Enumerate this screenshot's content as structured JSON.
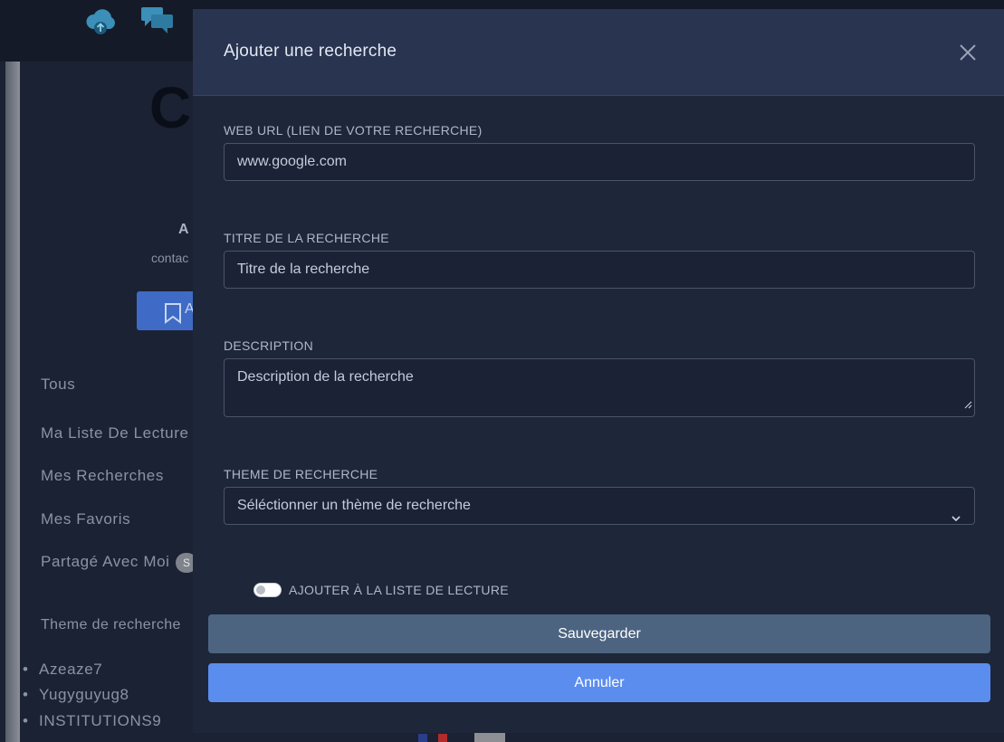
{
  "background": {
    "logo_text": "C",
    "profile_name": "A",
    "profile_email": "contac",
    "add_button_label": "A",
    "nav_items": [
      "Tous",
      "Ma Liste De Lecture",
      "Mes Recherches",
      "Mes Favoris",
      "Partagé Avec Moi"
    ],
    "shared_badge": "S",
    "themes_heading": "Theme de recherche",
    "theme_items": [
      "Azeaze7",
      "Yugyguyug8",
      "INSTITUTIONS9"
    ]
  },
  "modal": {
    "title": "Ajouter une recherche",
    "url": {
      "label": "WEB URL (LIEN DE VOTRE RECHERCHE)",
      "value": "www.google.com"
    },
    "titre": {
      "label": "TITRE DE LA RECHERCHE",
      "placeholder": "Titre de la recherche"
    },
    "description": {
      "label": "DESCRIPTION",
      "placeholder": "Description de la recherche"
    },
    "theme": {
      "label": "THEME DE RECHERCHE",
      "selected": "Séléctionner un thème de recherche"
    },
    "reading_list_toggle": {
      "label": "AJOUTER À LA LISTE DE LECTURE",
      "checked": false
    },
    "save_label": "Sauvegarder",
    "cancel_label": "Annuler"
  },
  "colors": {
    "save": "#4d6481",
    "cancel": "#5b8def",
    "header": "#283450",
    "body": "#1e2639"
  }
}
